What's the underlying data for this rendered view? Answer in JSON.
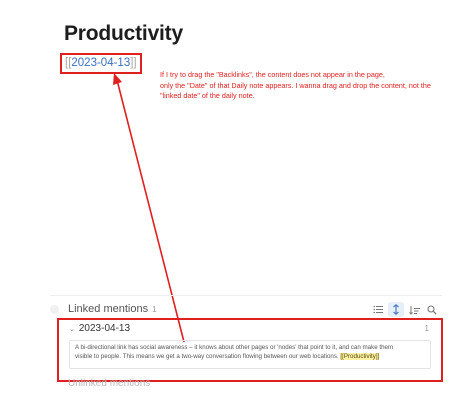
{
  "page": {
    "title": "Productivity",
    "date_link": {
      "open": "[[",
      "text": "2023-04-13",
      "close": "]]"
    }
  },
  "annotation": {
    "lines": [
      "If I try to drag the \"Backlinks\", the content does not appear in the page,",
      "only the \"Date\" of that Daily note appears. I wanna drag and drop the content, not the",
      "\"linked date\" of the daily note."
    ]
  },
  "linked_mentions": {
    "title": "Linked mentions",
    "count": "1",
    "tools": [
      {
        "name": "list-icon",
        "active": false
      },
      {
        "name": "sort-icon",
        "active": true
      },
      {
        "name": "filter-icon",
        "active": false
      },
      {
        "name": "search-icon",
        "active": false
      }
    ],
    "reference": {
      "date": "2023-04-13",
      "count": "1",
      "text_line1": "A bi-directional link has social awareness – it knows about other pages or 'nodes' that point to it, and can make them",
      "text_line2": "visible to people. This means we get a two-way conversation flowing between our web locations. ",
      "link_text": "[[Productivity]]"
    }
  },
  "unlinked_mentions": {
    "title": "Unlinked mentions"
  },
  "colors": {
    "annotation": "#e02020",
    "link": "#3a6fbf",
    "highlight": "#fbf0a8"
  }
}
